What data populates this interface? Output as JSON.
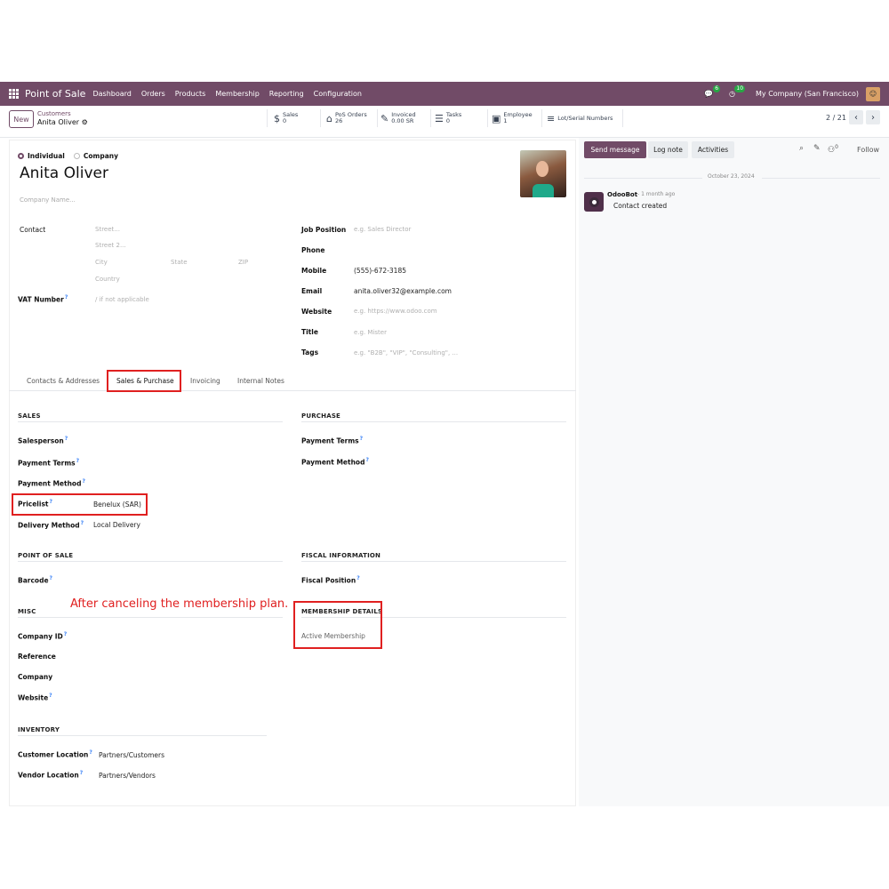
{
  "topbar": {
    "app_name": "Point of Sale",
    "nav": [
      "Dashboard",
      "Orders",
      "Products",
      "Membership",
      "Reporting",
      "Configuration"
    ],
    "msg_badge": "6",
    "activity_badge": "10",
    "company": "My Company (San Francisco)"
  },
  "cpanel": {
    "new_label": "New",
    "breadcrumb_parent": "Customers",
    "breadcrumb_current": "Anita Oliver",
    "smart_buttons": {
      "sales": {
        "label": "Sales",
        "value": "0"
      },
      "pos_orders": {
        "label": "PoS Orders",
        "value": "26"
      },
      "invoiced": {
        "label": "Invoiced",
        "value": "0.00 SR"
      },
      "tasks": {
        "label": "Tasks",
        "value": "0"
      },
      "employee": {
        "label": "Employee",
        "value": "1"
      },
      "lots": {
        "label": "Lot/Serial Numbers"
      }
    },
    "pager": "2 / 21"
  },
  "form": {
    "type_individual": "Individual",
    "type_company": "Company",
    "name": "Anita Oliver",
    "company_placeholder": "Company Name...",
    "contact_label": "Contact",
    "street_ph": "Street...",
    "street2_ph": "Street 2...",
    "city_ph": "City",
    "state_ph": "State",
    "zip_ph": "ZIP",
    "country_ph": "Country",
    "vat_label": "VAT Number",
    "vat_ph": "/ if not applicable",
    "job_label": "Job Position",
    "job_ph": "e.g. Sales Director",
    "phone_label": "Phone",
    "mobile_label": "Mobile",
    "mobile_value": "(555)-672-3185",
    "email_label": "Email",
    "email_value": "anita.oliver32@example.com",
    "website_label": "Website",
    "website_ph": "e.g. https://www.odoo.com",
    "title_label": "Title",
    "title_ph": "e.g. Mister",
    "tags_label": "Tags",
    "tags_ph": "e.g. \"B2B\", \"VIP\", \"Consulting\", ..."
  },
  "tabs": [
    "Contacts & Addresses",
    "Sales & Purchase",
    "Invoicing",
    "Internal Notes"
  ],
  "sales": {
    "title": "SALES",
    "salesperson": "Salesperson",
    "payment_terms": "Payment Terms",
    "payment_method": "Payment Method",
    "pricelist": "Pricelist",
    "pricelist_value": "Benelux (SAR)",
    "delivery_method": "Delivery Method",
    "delivery_value": "Local Delivery"
  },
  "purchase": {
    "title": "PURCHASE",
    "payment_terms": "Payment Terms",
    "payment_method": "Payment Method"
  },
  "pos": {
    "title": "POINT OF SALE",
    "barcode": "Barcode"
  },
  "fiscal": {
    "title": "FISCAL INFORMATION",
    "position": "Fiscal Position"
  },
  "misc": {
    "title": "MISC",
    "company_id": "Company ID",
    "reference": "Reference",
    "company": "Company",
    "website": "Website"
  },
  "membership": {
    "title": "MEMBERSHIP DETAILS",
    "active": "Active Membership"
  },
  "inventory": {
    "title": "INVENTORY",
    "customer_location": "Customer Location",
    "customer_location_value": "Partners/Customers",
    "vendor_location": "Vendor Location",
    "vendor_location_value": "Partners/Vendors"
  },
  "annotation": "After canceling the membership plan.",
  "chatter": {
    "send": "Send message",
    "log": "Log note",
    "activities": "Activities",
    "followers_count": "0",
    "follow": "Follow",
    "date": "October 23, 2024",
    "author": "OdooBot",
    "time": "- 1 month ago",
    "message": "Contact created"
  }
}
